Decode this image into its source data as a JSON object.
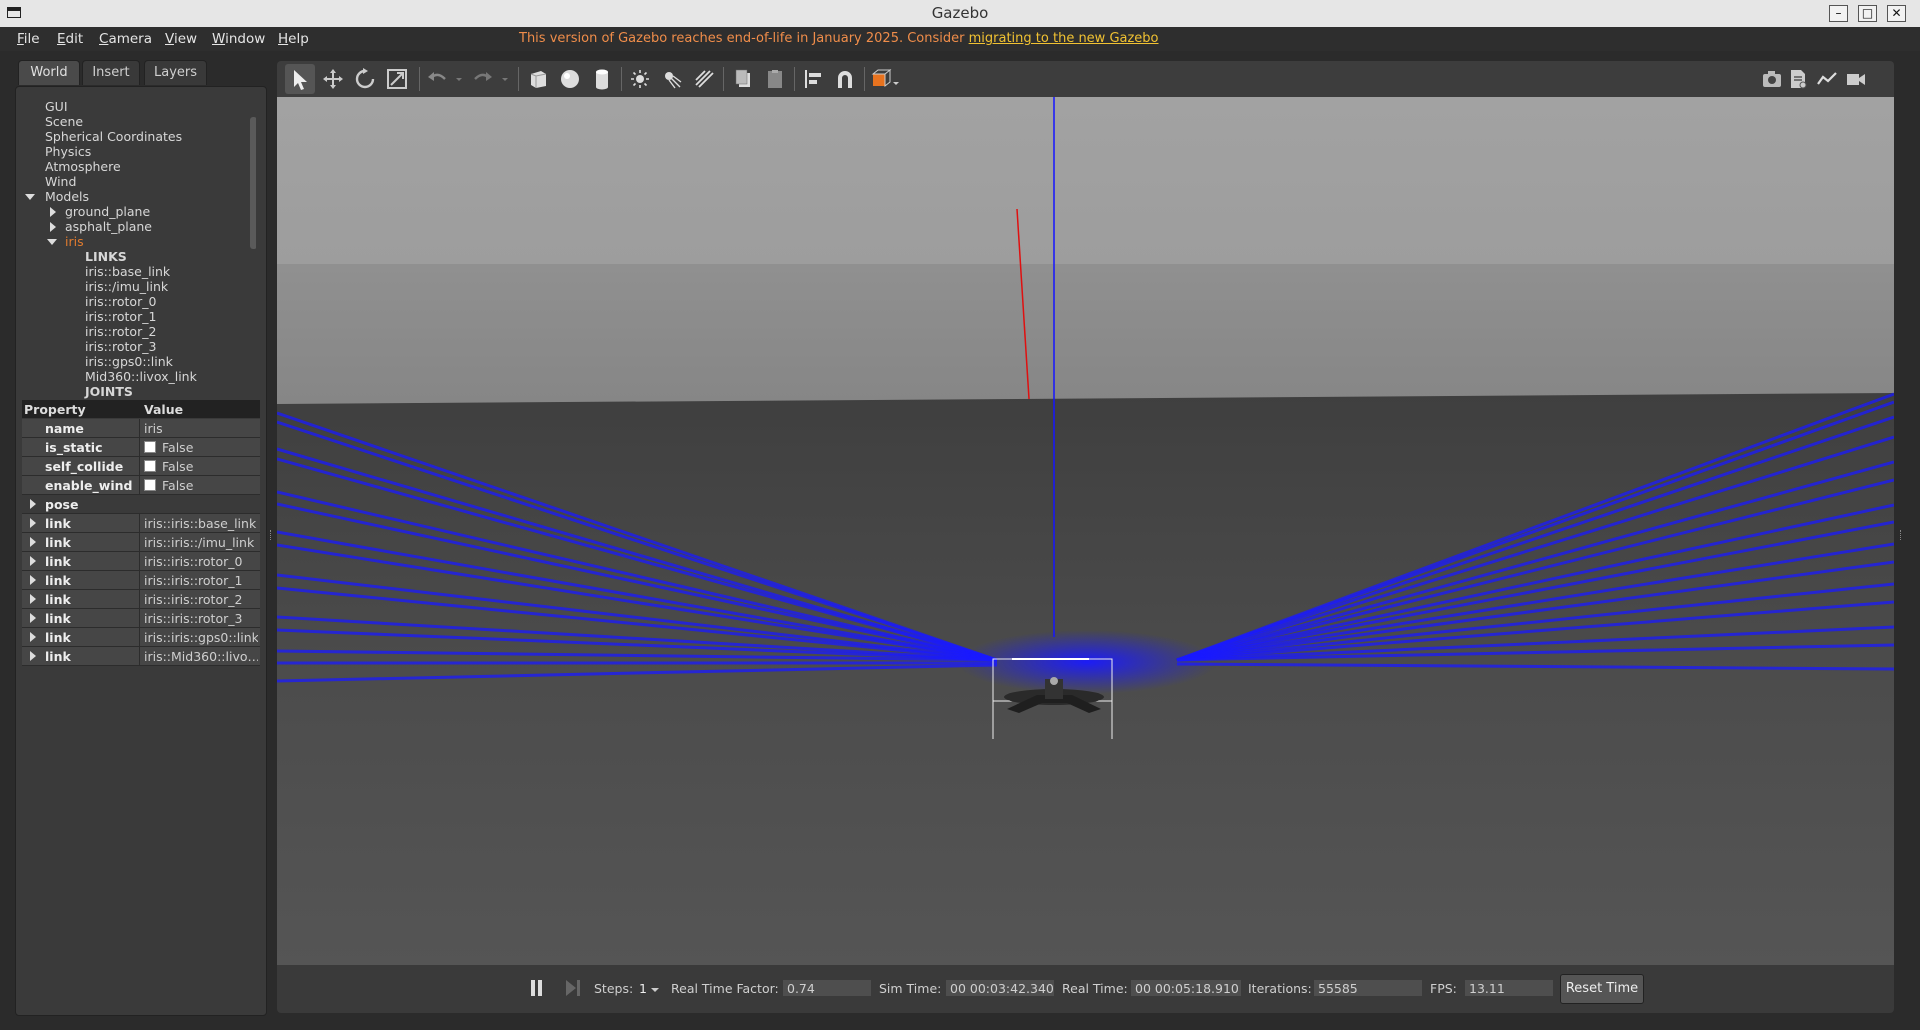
{
  "window": {
    "title": "Gazebo"
  },
  "menu": {
    "items": [
      {
        "label": "File",
        "u": "F",
        "rest": "ile"
      },
      {
        "label": "Edit",
        "u": "E",
        "rest": "dit"
      },
      {
        "label": "Camera",
        "u": "C",
        "rest": "amera"
      },
      {
        "label": "View",
        "u": "V",
        "rest": "iew"
      },
      {
        "label": "Window",
        "u": "W",
        "rest": "indow"
      },
      {
        "label": "Help",
        "u": "H",
        "rest": "elp"
      }
    ],
    "banner_text": "This version of Gazebo reaches end-of-life in January 2025. Consider ",
    "banner_link": "migrating to the new Gazebo"
  },
  "tabs": [
    "World",
    "Insert",
    "Layers"
  ],
  "tree": {
    "items": [
      "GUI",
      "Scene",
      "Spherical Coordinates",
      "Physics",
      "Atmosphere",
      "Wind",
      "Models"
    ],
    "models": [
      "ground_plane",
      "asphalt_plane",
      "iris"
    ],
    "links_header": "LINKS",
    "links": [
      "iris::base_link",
      "iris::/imu_link",
      "iris::rotor_0",
      "iris::rotor_1",
      "iris::rotor_2",
      "iris::rotor_3",
      "iris::gps0::link",
      "Mid360::livox_link"
    ],
    "joints_header": "JOINTS"
  },
  "properties": {
    "header_property": "Property",
    "header_value": "Value",
    "rows": [
      {
        "key": "name",
        "value": "iris"
      },
      {
        "key": "is_static",
        "value": "False"
      },
      {
        "key": "self_collide",
        "value": "False"
      },
      {
        "key": "enable_wind",
        "value": "False"
      },
      {
        "key": "pose",
        "value": ""
      },
      {
        "key": "link",
        "value": "iris::iris::base_link"
      },
      {
        "key": "link",
        "value": "iris::iris::/imu_link"
      },
      {
        "key": "link",
        "value": "iris::iris::rotor_0"
      },
      {
        "key": "link",
        "value": "iris::iris::rotor_1"
      },
      {
        "key": "link",
        "value": "iris::iris::rotor_2"
      },
      {
        "key": "link",
        "value": "iris::iris::rotor_3"
      },
      {
        "key": "link",
        "value": "iris::iris::gps0::link"
      },
      {
        "key": "link",
        "value": "iris::Mid360::livo…"
      }
    ]
  },
  "bottom": {
    "steps_label": "Steps:",
    "steps_value": "1",
    "rtf_label": "Real Time Factor:",
    "rtf_value": "0.74",
    "sim_time_label": "Sim Time:",
    "sim_time_value": "00 00:03:42.340",
    "real_time_label": "Real Time:",
    "real_time_value": "00 00:05:18.910",
    "iterations_label": "Iterations:",
    "iterations_value": "55585",
    "fps_label": "FPS:",
    "fps_value": "13.11",
    "reset_label": "Reset Time"
  },
  "colors": {
    "accent_orange": "#f08d4a",
    "selected_model": "#e07b2f",
    "laser_blue": "#1a1aff"
  }
}
